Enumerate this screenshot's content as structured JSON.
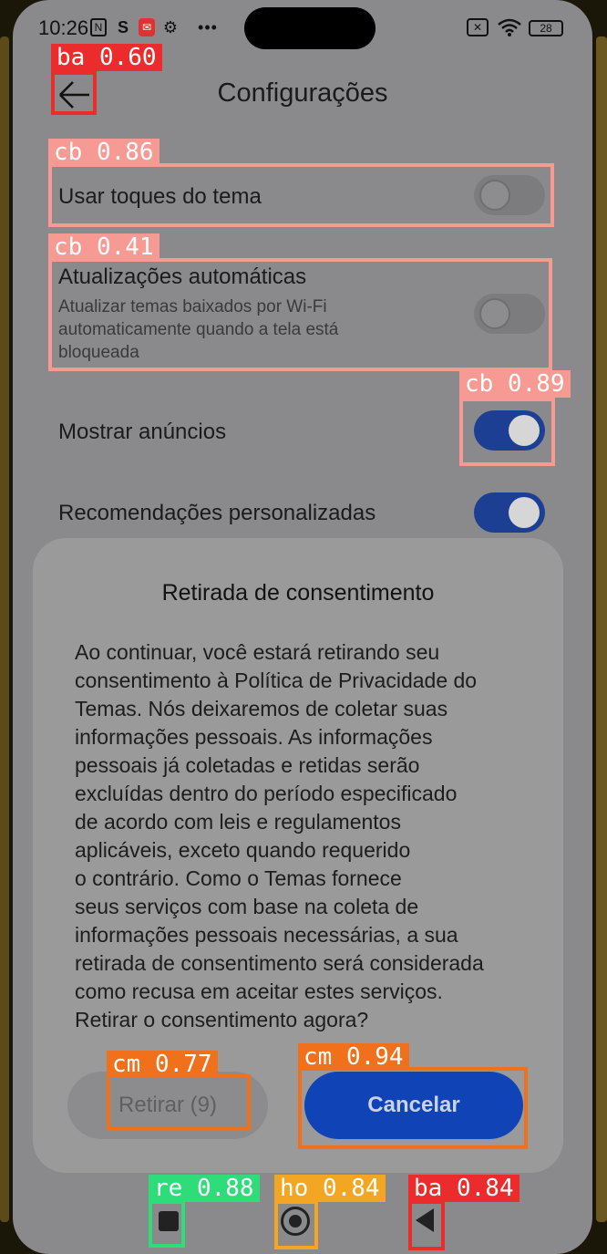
{
  "status_bar": {
    "time": "10:26",
    "battery": "28",
    "icons": [
      "nfc-icon",
      "s-icon",
      "mail-icon",
      "gear-icon",
      "more-dots-icon",
      "no-sim-icon",
      "wifi-icon",
      "battery-icon"
    ]
  },
  "header": {
    "title": "Configurações",
    "back_icon": "arrow-left-icon"
  },
  "settings": [
    {
      "title": "Usar toques do tema",
      "subtitle": "",
      "toggle_on": false
    },
    {
      "title": "Atualizações automáticas",
      "subtitle_lines": [
        "Atualizar temas baixados por Wi-Fi",
        "automaticamente quando a tela está",
        "bloqueada"
      ],
      "toggle_on": false
    },
    {
      "title": "Mostrar anúncios",
      "toggle_on": true
    },
    {
      "title": "Recomendações personalizadas",
      "toggle_on": true
    }
  ],
  "dialog": {
    "title": "Retirada de consentimento",
    "body_lines": [
      "Ao continuar, você estará retirando seu",
      "consentimento à Política de Privacidade do",
      "Temas. Nós deixaremos de coletar suas",
      "informações pessoais. As informações",
      "pessoais já coletadas e retidas serão",
      "excluídas dentro do período especificado",
      "de acordo com leis e regulamentos",
      "aplicáveis, exceto quando requerido",
      "o contrário. Como o Temas fornece",
      "seus serviços com base na coleta de",
      "informações pessoais necessárias, a sua",
      "retirada de consentimento será considerada",
      "como recusa em aceitar estes serviços.",
      "Retirar o consentimento agora?"
    ],
    "withdraw_label": "Retirar (9)",
    "cancel_label": "Cancelar"
  },
  "nav_bar": {
    "icons": [
      "recent-apps-icon",
      "home-icon",
      "back-triangle-icon"
    ]
  },
  "detections": [
    {
      "label": "ba 0.60",
      "color": "#ec2c2c"
    },
    {
      "label": "cb 0.86",
      "color": "#f79a94"
    },
    {
      "label": "cb 0.41",
      "color": "#f79a94"
    },
    {
      "label": "cb 0.89",
      "color": "#f79a94"
    },
    {
      "label": "cm 0.77",
      "color": "#f0701c"
    },
    {
      "label": "cm 0.94",
      "color": "#f0701c"
    },
    {
      "label": "re 0.88",
      "color": "#2fdc7a"
    },
    {
      "label": "ho 0.84",
      "color": "#f2a622"
    },
    {
      "label": "ba 0.84",
      "color": "#ec2c2c"
    }
  ]
}
